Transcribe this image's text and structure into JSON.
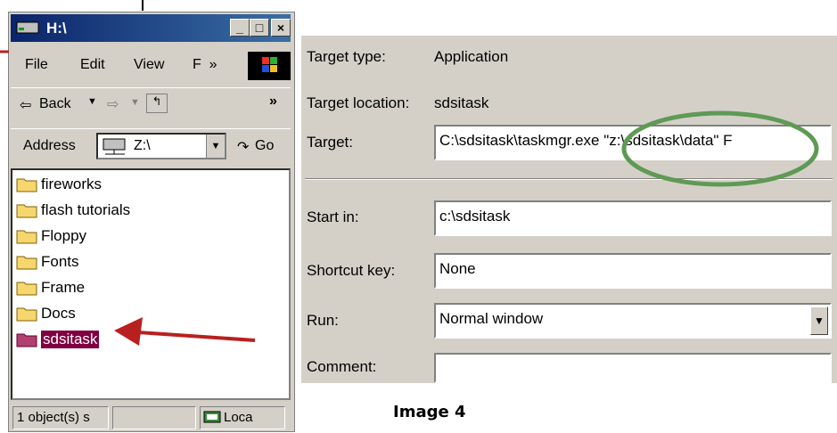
{
  "window": {
    "title": "H:\\",
    "controls": [
      "_",
      "□",
      "×"
    ],
    "menu": [
      "File",
      "Edit",
      "View",
      "F  »"
    ],
    "toolbar": {
      "back_label": "Back",
      "more_label": "»"
    },
    "address": {
      "label": "Address",
      "value": "Z:\\",
      "go_label": "Go"
    },
    "files": [
      {
        "name": "fireworks",
        "selected": false
      },
      {
        "name": "flash tutorials",
        "selected": false
      },
      {
        "name": "Floppy",
        "selected": false
      },
      {
        "name": "Fonts",
        "selected": false
      },
      {
        "name": "Frame",
        "selected": false
      },
      {
        "name": "Docs",
        "selected": false
      },
      {
        "name": "sdsitask",
        "selected": true
      }
    ],
    "status": {
      "count": "1 object(s) s",
      "zone": "Loca"
    }
  },
  "properties": {
    "target_type_label": "Target type:",
    "target_type_value": "Application",
    "target_location_label": "Target location:",
    "target_location_value": "sdsitask",
    "target_label": "Target:",
    "target_value": "C:\\sdsitask\\taskmgr.exe \"z:\\sdsitask\\data\" F",
    "start_in_label": "Start in:",
    "start_in_value": "c:\\sdsitask",
    "shortcut_key_label": "Shortcut key:",
    "shortcut_key_value": "None",
    "run_label": "Run:",
    "run_value": "Normal window",
    "comment_label": "Comment:",
    "comment_value": ""
  },
  "caption": "Image 4",
  "colors": {
    "title_start": "#0a246a",
    "title_end": "#3a6ea5",
    "selection": "#800040",
    "arrow": "#b82020",
    "highlight_ellipse": "#5f9a55"
  }
}
